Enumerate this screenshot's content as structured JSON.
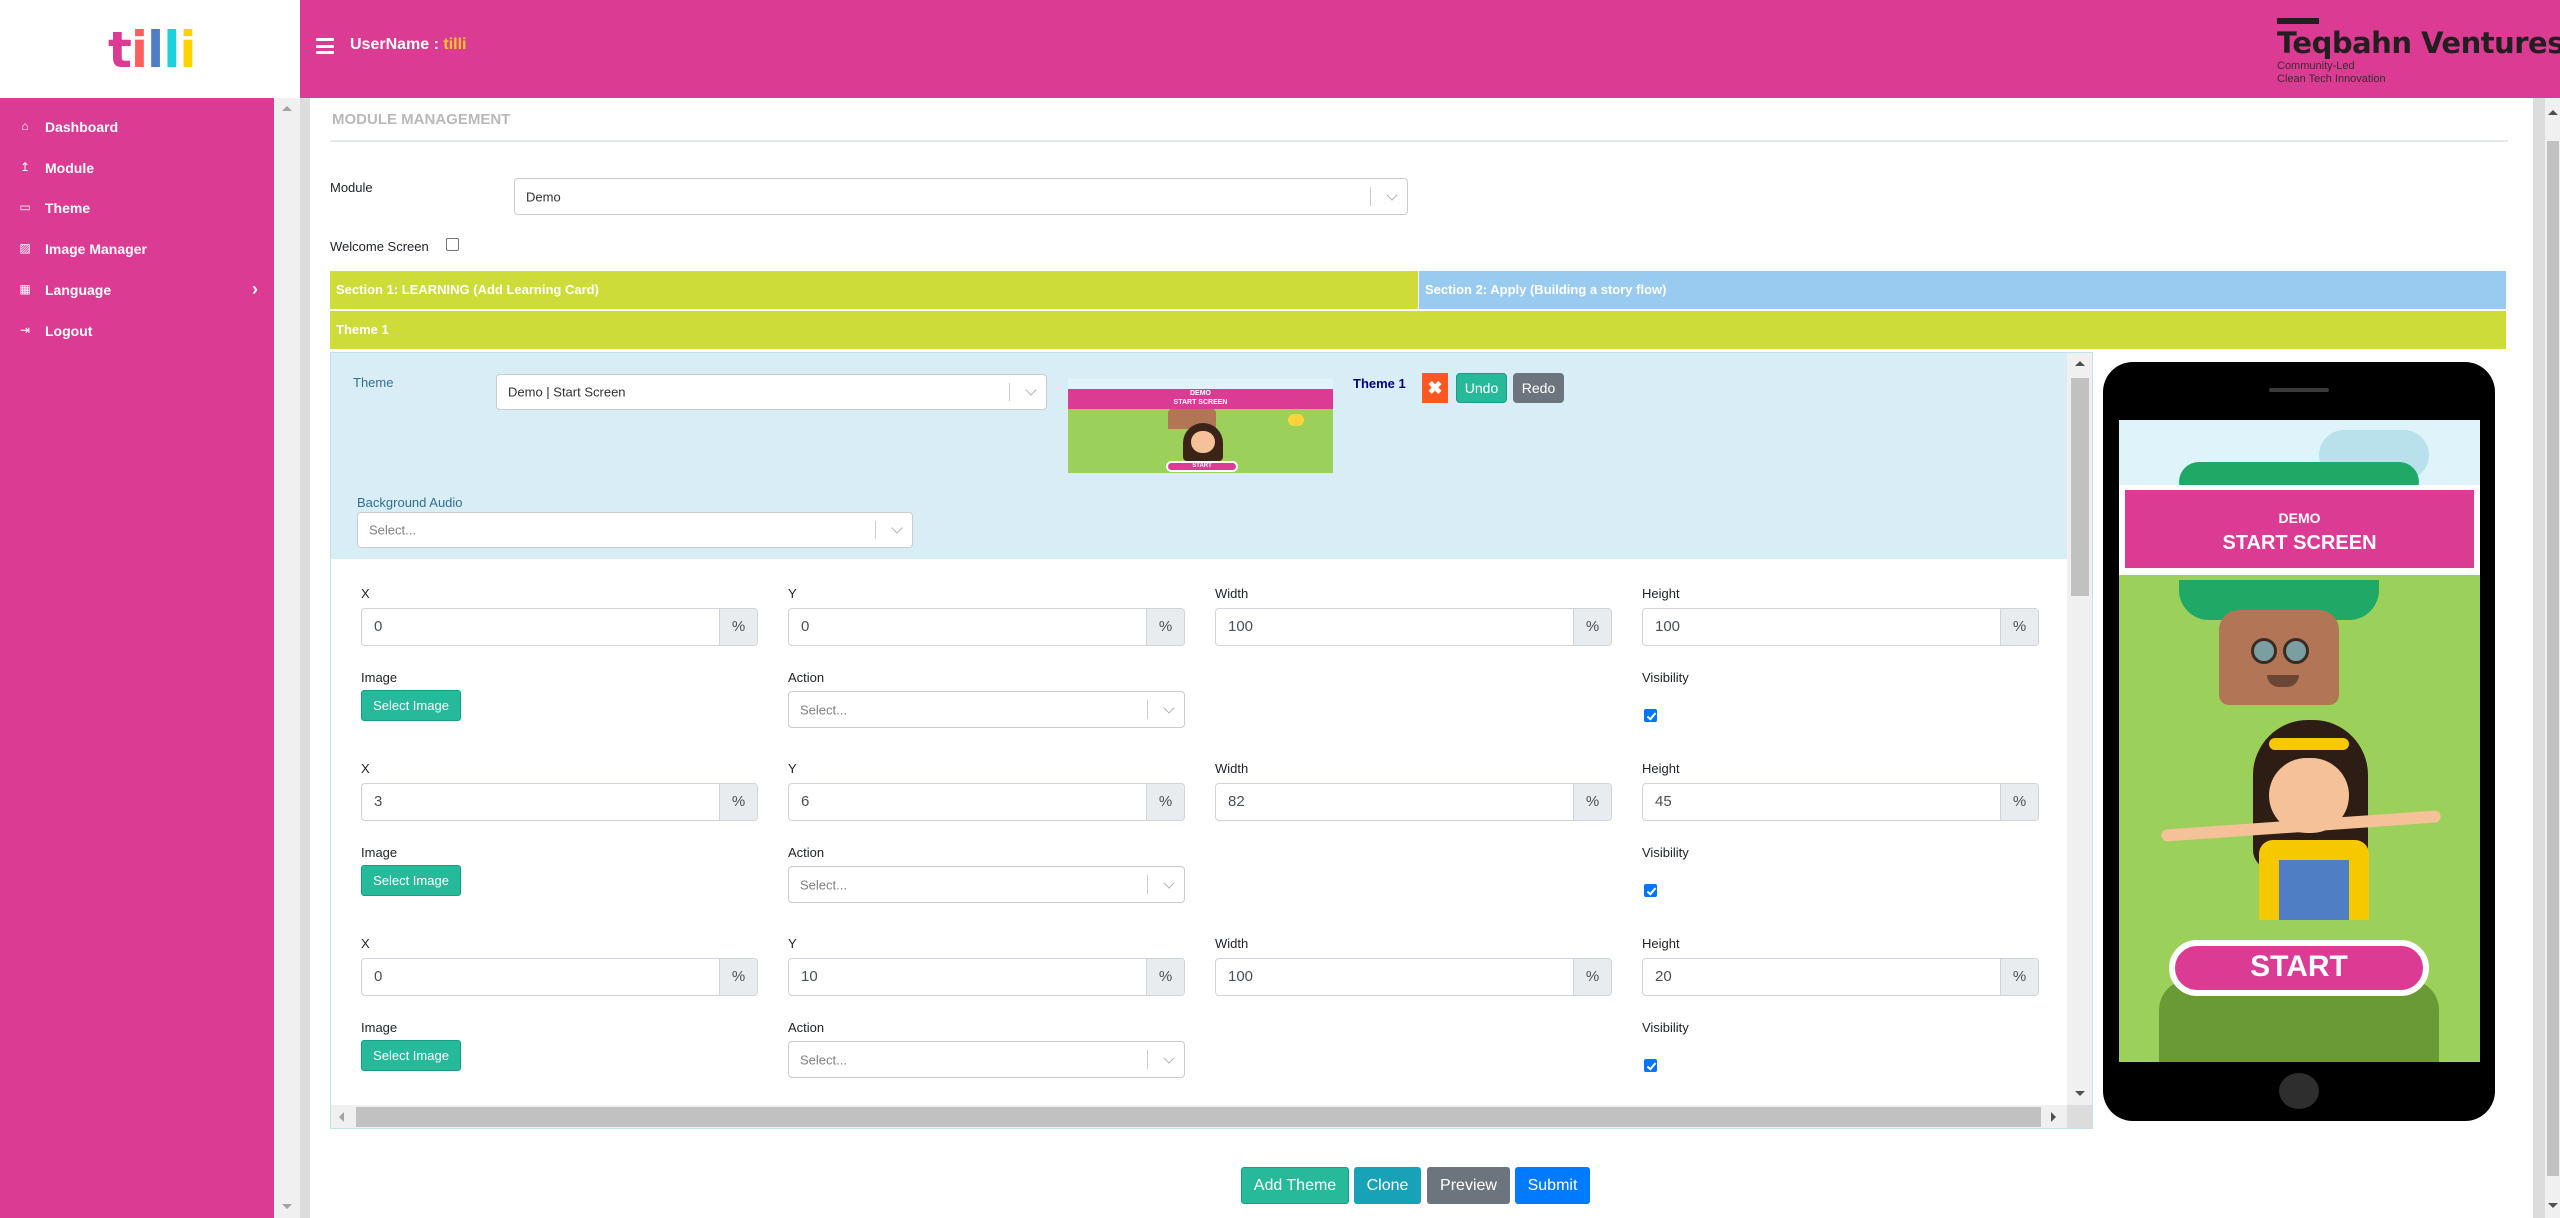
{
  "header": {
    "logo_letters": [
      {
        "ch": "t",
        "color": "#dc3b93"
      },
      {
        "ch": "i",
        "color": "#ff5f5f"
      },
      {
        "ch": "l",
        "color": "#4f7ec5"
      },
      {
        "ch": "l",
        "color": "#1ecfdc"
      },
      {
        "ch": "i",
        "color": "#ffd200"
      }
    ],
    "username_label": "UserName : ",
    "username_value": "tilli",
    "brand_name": "Teqbahn Ventures",
    "brand_tagline_1": "Community-Led",
    "brand_tagline_2": "Clean Tech Innovation",
    "colors": {
      "primary": "#dc3b93",
      "username_accent": "#ffc928"
    }
  },
  "sidebar": {
    "items": [
      {
        "label": "Dashboard",
        "icon": "home-icon",
        "glyph": "⌂"
      },
      {
        "label": "Module",
        "icon": "upload-icon",
        "glyph": "↥"
      },
      {
        "label": "Theme",
        "icon": "monitor-icon",
        "glyph": "▭"
      },
      {
        "label": "Image Manager",
        "icon": "image-icon",
        "glyph": "▨"
      },
      {
        "label": "Language",
        "icon": "language-icon",
        "glyph": "▦",
        "has_submenu": true,
        "chevron": "›"
      },
      {
        "label": "Logout",
        "icon": "logout-icon",
        "glyph": "⇥"
      }
    ]
  },
  "main": {
    "title": "MODULE MANAGEMENT",
    "module_label": "Module",
    "module_value": "Demo",
    "welcome_screen_label": "Welcome Screen",
    "welcome_screen_checked": false,
    "sections": [
      {
        "label": "Section 1: LEARNING (Add Learning Card)",
        "color": "#cddc39",
        "active": true
      },
      {
        "label": "Section 2: Apply (Building a story flow)",
        "color": "#99cbf1",
        "active": false
      }
    ],
    "theme_tab_label": "Theme 1",
    "theme_panel": {
      "theme_label": "Theme",
      "theme_value": "Demo | Start Screen",
      "theme_name": "Theme 1",
      "delete_glyph": "✖",
      "undo_label": "Undo",
      "redo_label": "Redo",
      "background_audio_label": "Background Audio",
      "background_audio_placeholder": "Select...",
      "thumb_line1": "DEMO",
      "thumb_line2": "START SCREEN",
      "thumb_start": "START"
    },
    "layer_labels": {
      "x": "X",
      "y": "Y",
      "width": "Width",
      "height": "Height",
      "image": "Image",
      "action": "Action",
      "visibility": "Visibility",
      "unit": "%",
      "select_image": "Select Image",
      "action_placeholder": "Select..."
    },
    "layers": [
      {
        "x": "0",
        "y": "0",
        "width": "100",
        "height": "100",
        "visible": true
      },
      {
        "x": "3",
        "y": "6",
        "width": "82",
        "height": "45",
        "visible": true
      },
      {
        "x": "0",
        "y": "10",
        "width": "100",
        "height": "20",
        "visible": true
      }
    ]
  },
  "preview": {
    "line1": "DEMO",
    "line2": "START SCREEN",
    "start_label": "START"
  },
  "footer_buttons": {
    "add_theme": "Add Theme",
    "clone": "Clone",
    "preview": "Preview",
    "submit": "Submit"
  }
}
